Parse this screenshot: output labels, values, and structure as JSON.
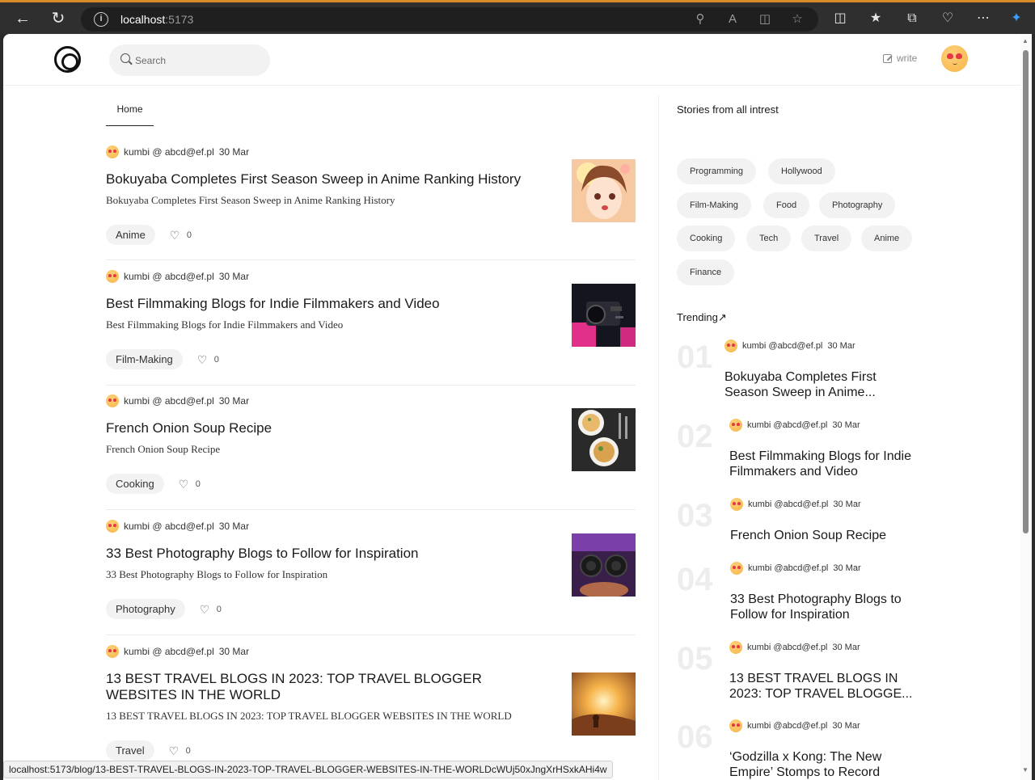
{
  "browser": {
    "url_host": "localhost",
    "url_port": ":5173",
    "status_link": "localhost:5173/blog/13-BEST-TRAVEL-BLOGS-IN-2023-TOP-TRAVEL-BLOGGER-WEBSITES-IN-THE-WORLDcWUj50xJngXrHSxkAHi4w"
  },
  "header": {
    "search_placeholder": "Search",
    "write_label": "write"
  },
  "feed": {
    "tab": "Home",
    "posts": [
      {
        "author": "kumbi @ abcd@ef.pl",
        "date": "30 Mar",
        "title": "Bokuyaba Completes First Season Sweep in Anime Ranking History",
        "desc": "Bokuyaba Completes First Season Sweep in Anime Ranking History",
        "tag": "Anime",
        "likes": "0"
      },
      {
        "author": "kumbi @ abcd@ef.pl",
        "date": "30 Mar",
        "title": "Best Filmmaking Blogs for Indie Filmmakers and Video",
        "desc": "Best Filmmaking Blogs for Indie Filmmakers and Video",
        "tag": "Film-Making",
        "likes": "0"
      },
      {
        "author": "kumbi @ abcd@ef.pl",
        "date": "30 Mar",
        "title": "French Onion Soup Recipe",
        "desc": "French Onion Soup Recipe",
        "tag": "Cooking",
        "likes": "0"
      },
      {
        "author": "kumbi @ abcd@ef.pl",
        "date": "30 Mar",
        "title": "33 Best Photography Blogs to Follow for Inspiration",
        "desc": "33 Best Photography Blogs to Follow for Inspiration",
        "tag": "Photography",
        "likes": "0"
      },
      {
        "author": "kumbi @ abcd@ef.pl",
        "date": "30 Mar",
        "title": "13 BEST TRAVEL BLOGS IN 2023: TOP TRAVEL BLOGGER WEBSITES IN THE WORLD",
        "desc": "13 BEST TRAVEL BLOGS IN 2023: TOP TRAVEL BLOGGER WEBSITES IN THE WORLD",
        "tag": "Travel",
        "likes": "0"
      }
    ]
  },
  "sidebar": {
    "interests_heading": "Stories from all intrest",
    "interests": [
      "Programming",
      "Hollywood",
      "Film-Making",
      "Food",
      "Photography",
      "Cooking",
      "Tech",
      "Travel",
      "Anime",
      "Finance"
    ],
    "trending_heading": "Trending↗",
    "trending": [
      {
        "num": "01",
        "author": "kumbi @abcd@ef.pl",
        "date": "30 Mar",
        "title": "Bokuyaba Completes First Season Sweep in Anime..."
      },
      {
        "num": "02",
        "author": "kumbi @abcd@ef.pl",
        "date": "30 Mar",
        "title": "Best Filmmaking Blogs for Indie Filmmakers and Video"
      },
      {
        "num": "03",
        "author": "kumbi @abcd@ef.pl",
        "date": "30 Mar",
        "title": "French Onion Soup Recipe"
      },
      {
        "num": "04",
        "author": "kumbi @abcd@ef.pl",
        "date": "30 Mar",
        "title": "33 Best Photography Blogs to Follow for Inspiration"
      },
      {
        "num": "05",
        "author": "kumbi @abcd@ef.pl",
        "date": "30 Mar",
        "title": "13 BEST TRAVEL BLOGS IN 2023: TOP TRAVEL BLOGGE..."
      },
      {
        "num": "06",
        "author": "kumbi @abcd@ef.pl",
        "date": "30 Mar",
        "title": "‘Godzilla x Kong: The New Empire’ Stomps to Record"
      }
    ]
  },
  "colors": {
    "accent_tab_border": "#d98b27",
    "chip_bg": "#f2f2f2"
  }
}
